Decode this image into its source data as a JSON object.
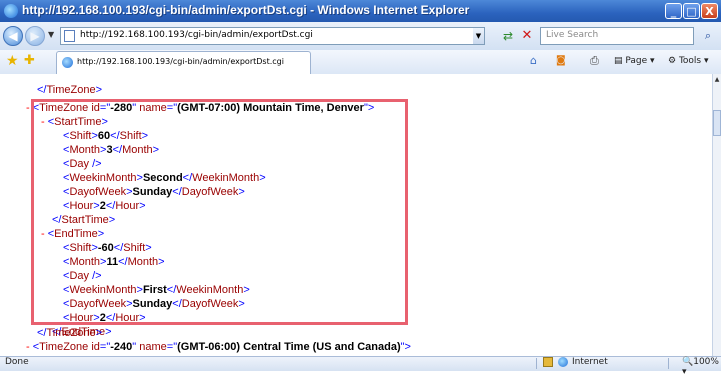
{
  "window": {
    "title": "http://192.168.100.193/cgi-bin/admin/exportDst.cgi - Windows Internet Explorer",
    "min_glyph": "_",
    "max_glyph": "□",
    "close_glyph": "X"
  },
  "nav": {
    "back_glyph": "◀",
    "forward_glyph": "▶",
    "address": "http://192.168.100.193/cgi-bin/admin/exportDst.cgi",
    "search_placeholder": "Live Search"
  },
  "tab": {
    "label": "http://192.168.100.193/cgi-bin/admin/exportDst.cgi"
  },
  "commands": {
    "page": "Page",
    "tools": "Tools"
  },
  "xml": {
    "open_tz_1": "TimeZone",
    "close_tz_1": "TimeZone",
    "tz2_id": "-280",
    "tz2_name": "(GMT-07:00) Mountain Time, Denver",
    "start_time": "StartTime",
    "end_time": "EndTime",
    "start": {
      "shift": "60",
      "month": "3",
      "weekin": "Second",
      "dow": "Sunday",
      "hour": "2"
    },
    "end": {
      "shift": "-60",
      "month": "11",
      "weekin": "First",
      "dow": "Sunday",
      "hour": "2"
    },
    "tz3_id": "-240",
    "tz3_name": "(GMT-06:00) Central Time (US and Canada)"
  },
  "status": {
    "left": "Done",
    "zone": "Internet",
    "zoom": "100%"
  },
  "colors": {
    "highlight": "#e8616f",
    "tag": "#990000",
    "bracket": "#0000ff"
  }
}
